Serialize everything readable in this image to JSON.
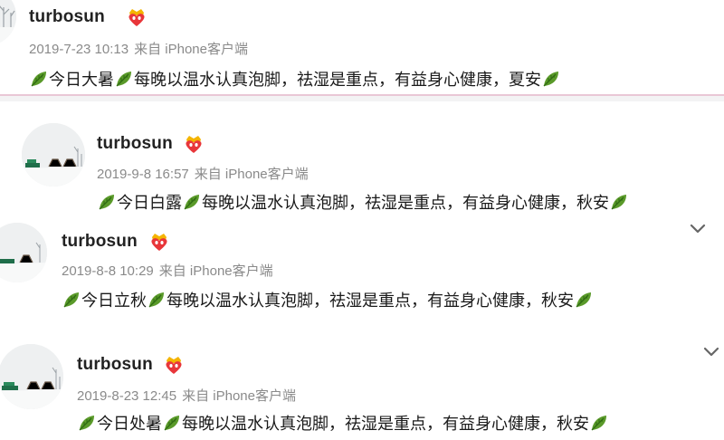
{
  "posts": [
    {
      "username": "turbosun",
      "timestamp": "2019-7-23 10:13",
      "source": "来自 iPhone客户端",
      "text_parts": [
        "今日大暑",
        "每晚以温水认真泡脚，祛湿是重点，有益身心健康，夏安"
      ],
      "badge": "crown-heart-badge",
      "has_more_menu": false
    },
    {
      "username": "turbosun",
      "timestamp": "2019-9-8 16:57",
      "source": "来自 iPhone客户端",
      "text_parts": [
        "今日白露",
        "每晚以温水认真泡脚，祛湿是重点，有益身心健康，秋安"
      ],
      "badge": "crown-heart-badge",
      "has_more_menu": false
    },
    {
      "username": "turbosun",
      "timestamp": "2019-8-8 10:29",
      "source": "来自 iPhone客户端",
      "text_parts": [
        "今日立秋",
        "每晚以温水认真泡脚，祛湿是重点，有益身心健康，秋安"
      ],
      "badge": "crown-heart-badge",
      "has_more_menu": true
    },
    {
      "username": "turbosun",
      "timestamp": "2019-8-23 12:45",
      "source": "来自 iPhone客户端",
      "text_parts": [
        "今日处暑",
        "每晚以温水认真泡脚，祛湿是重点，有益身心健康，秋安"
      ],
      "badge": "crown-heart-badge",
      "has_more_menu": true
    }
  ],
  "icons": {
    "leaf": "leaf-emoji-icon",
    "chevron": "chevron-down-icon",
    "badge": "crown-heart-badge"
  },
  "colors": {
    "username": "#222222",
    "meta": "#8a8a8a",
    "text": "#1a1a1a",
    "leaf": "#5a9a2a",
    "badge_heart": "#e8363a",
    "badge_crown": "#f4b400",
    "divider": "#e9c7d6"
  }
}
